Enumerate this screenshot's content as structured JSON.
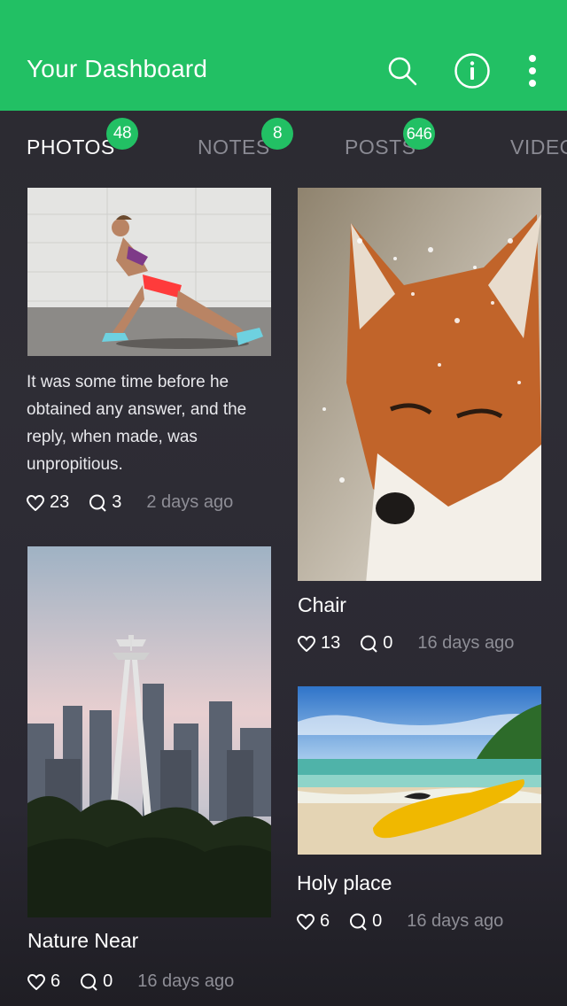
{
  "header": {
    "title": "Your Dashboard",
    "accent_color": "#22c064",
    "actions": [
      {
        "icon": "search-icon"
      },
      {
        "icon": "info-icon"
      },
      {
        "icon": "more-vertical-icon"
      }
    ]
  },
  "tabs": [
    {
      "label": "PHOTOS",
      "badge": "48",
      "active": true
    },
    {
      "label": "NOTES",
      "badge": "8",
      "active": false
    },
    {
      "label": "POSTS",
      "badge": "646",
      "active": false
    },
    {
      "label": "VIDEO",
      "badge": "",
      "active": false
    }
  ],
  "feed": [
    {
      "image": "woman-stretching-photo",
      "text": "It was some time before he obtained any answer, and the reply, when made, was unpropitious.",
      "likes": "23",
      "comments": "3",
      "age": "2 days ago"
    },
    {
      "image": "snowy-fox-photo",
      "caption": "Chair",
      "likes": "13",
      "comments": "0",
      "age": "16 days ago"
    },
    {
      "image": "city-skyline-photo",
      "caption": "Nature Near",
      "likes": "6",
      "comments": "0",
      "age": "16 days ago"
    },
    {
      "image": "beach-kayak-photo",
      "caption": "Holy place",
      "likes": "6",
      "comments": "0",
      "age": "16 days ago"
    }
  ]
}
